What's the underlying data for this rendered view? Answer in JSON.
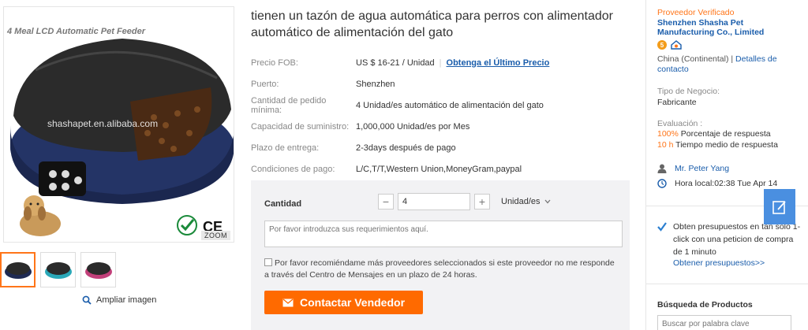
{
  "product": {
    "image_banner": "4 Meal LCD Automatic Pet Feeder",
    "watermark": "shashapet.en.alibaba.com",
    "zoom_label": "ZOOM",
    "ce_mark": "CE",
    "rohs_mark": "RoHS",
    "enlarge_label": "Ampliar imagen",
    "thumb_colors": [
      "#1f2a52",
      "#2aa8b8",
      "#c2407a"
    ],
    "body_color": "#243466",
    "lid_color": "#2a2a2a",
    "title": "tienen un tazón de agua automática para perros con alimentador automático de alimentación del gato"
  },
  "specs": [
    {
      "label": "Precio FOB:",
      "value": "US $ 16-21 / Unidad",
      "link": "Obtenga el Último Precio"
    },
    {
      "label": "Puerto:",
      "value": "Shenzhen"
    },
    {
      "label": "Cantidad de pedido mínima:",
      "value": "4 Unidad/es automático de alimentación del gato"
    },
    {
      "label": "Capacidad de suministro:",
      "value": "1,000,000 Unidad/es por Mes"
    },
    {
      "label": "Plazo de entrega:",
      "value": "2-3days después de pago"
    },
    {
      "label": "Condiciones de pago:",
      "value": "L/C,T/T,Western Union,MoneyGram,paypal"
    }
  ],
  "order": {
    "qty_label": "Cantidad",
    "minus": "−",
    "plus": "+",
    "qty_value": "4",
    "unit": "Unidad/es",
    "requirements_placeholder": "Por favor introduzca sus requerimientos aquí.",
    "recommend_text": "Por favor recomiéndame más proveedores seleccionados si este proveedor no me responde a través del Centro de Mensajes en un plazo de 24 horas.",
    "contact_button": "Contactar Vendedor"
  },
  "supplier": {
    "verified": "Proveedor Verificado",
    "company": "Shenzhen Shasha Pet Manufacturing Co., Limited",
    "gold_badge": "5",
    "country": "China (Continental)",
    "details_link": "Detalles de contacto",
    "business_type_label": "Tipo de Negocio:",
    "business_type": "Fabricante",
    "evaluation_label": "Evaluación :",
    "response_pct": "100%",
    "response_pct_label": "Porcentaje de respuesta",
    "response_time": "10 h",
    "response_time_label": "Tiempo medio de respuesta",
    "contact_person": "Mr. Peter Yang",
    "local_time": "Hora local:02:38 Tue Apr 14"
  },
  "quotes": {
    "text": "Obten presupuestos en tan solo 1-click con una peticion de compra de 1 minuto",
    "link": "Obtener presupuestos>>"
  },
  "search": {
    "title": "Búsqueda de Productos",
    "placeholder": "Buscar por palabra clave"
  },
  "colors": {
    "accent": "#ff6a00",
    "link": "#1a5dab"
  }
}
